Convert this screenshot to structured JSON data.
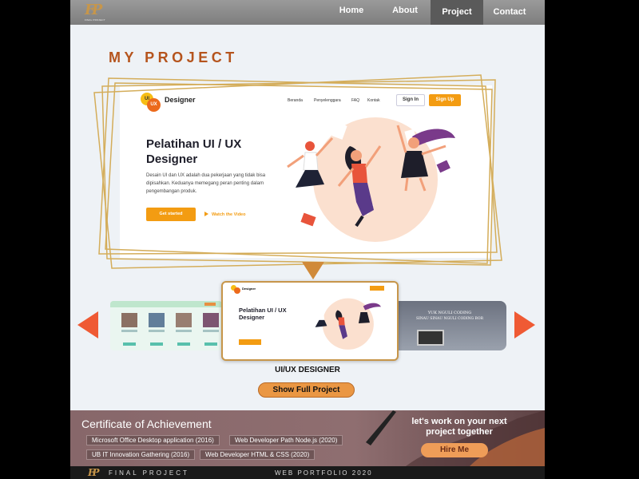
{
  "nav": {
    "logo_mark": "FP",
    "logo_sub": "FINAL PROJECT",
    "items": [
      "Home",
      "About",
      "Project",
      "Contact"
    ],
    "active": "Project"
  },
  "section_title": "MY PROJECT",
  "preview": {
    "brand": "Designer",
    "logo_ui": "UI",
    "logo_ux": "UX",
    "menu": [
      "Beranda",
      "Penyelenggara",
      "FAQ",
      "Kontak"
    ],
    "sign_in": "Sign In",
    "sign_up": "Sign Up",
    "heading": "Pelatihan UI / UX Designer",
    "paragraph": "Desain UI dan UX adalah dua pekerjaan yang tidak bisa dipisahkan. Keduanya memegang peran penting dalam pengembangan produk.",
    "cta": "Get started",
    "watch": "Watch the Video"
  },
  "carousel": {
    "center_heading": "Pelatihan UI / UX Designer",
    "right_text_1": "YUK NGULI CODING",
    "right_text_2": "SINAU SINAU NGULI CODING BOR",
    "project_title": "UI/UX DESIGNER",
    "show_full": "Show Full Project"
  },
  "footer": {
    "cert_title": "Certificate of Achievement",
    "certificates": [
      "Microsoft Office Desktop application (2016)",
      "Web Developer Path Node.js (2020)",
      "UB IT Innovation Gathering (2016)",
      "Web Developer HTML & CSS (2020)"
    ],
    "cta_text": "let's work on your next project together",
    "hire": "Hire Me"
  },
  "bottom_bar": {
    "logo": "FP",
    "left": "FINAL PROJECT",
    "right": "WEB PORTFOLIO 2020"
  },
  "colors": {
    "accent": "#b5541d",
    "orange": "#f39c12",
    "gold": "#c7964a",
    "arrow": "#ef5a34"
  }
}
